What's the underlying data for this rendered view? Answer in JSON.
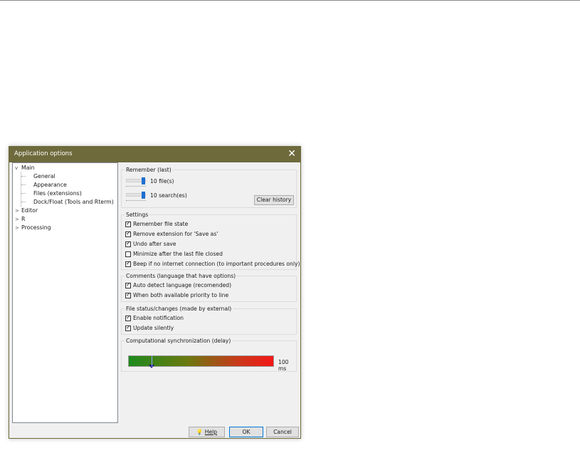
{
  "dialog": {
    "title": "Application options",
    "close_glyph": "✕"
  },
  "tree": {
    "items": [
      {
        "label": "Main",
        "chevron": "v"
      },
      {
        "label": "General"
      },
      {
        "label": "Appearance"
      },
      {
        "label": "Files (extensions)"
      },
      {
        "label": "Dock/Float (Tools and Rterm)"
      },
      {
        "label": "Editor",
        "chevron": ">"
      },
      {
        "label": "R",
        "chevron": ">"
      },
      {
        "label": "Processing",
        "chevron": ">"
      }
    ]
  },
  "remember": {
    "label": "Remember (last)",
    "files_value": "10 file(s)",
    "search_value": "10 search(es)",
    "clear_label": "Clear history"
  },
  "settings": {
    "label": "Settings",
    "items": [
      {
        "label": "Remember file state",
        "checked": true
      },
      {
        "label": "Remove extension for 'Save as'",
        "checked": true
      },
      {
        "label": "Undo after save",
        "checked": true
      },
      {
        "label": "Minimize after the last file closed",
        "checked": false
      },
      {
        "label": "Beep if no internet connection (to important procedures only)",
        "checked": true
      }
    ]
  },
  "comments": {
    "label": "Comments (language that have options)",
    "items": [
      {
        "label": "Auto detect language (recomended)",
        "checked": true
      },
      {
        "label": "When both available priority to line",
        "checked": true
      }
    ]
  },
  "file_status": {
    "label": "File status/changes (made by external)",
    "items": [
      {
        "label": "Enable notification",
        "checked": true
      },
      {
        "label": "Update silently",
        "checked": true
      }
    ]
  },
  "sync": {
    "label": "Computational synchronization (delay)",
    "value_text": "100 ms",
    "level_fraction": 0.16
  },
  "buttons": {
    "help": "Help",
    "ok": "OK",
    "cancel": "Cancel"
  },
  "colors": {
    "titlebar": "#6e6a3c",
    "accent": "#1f6fd1"
  }
}
